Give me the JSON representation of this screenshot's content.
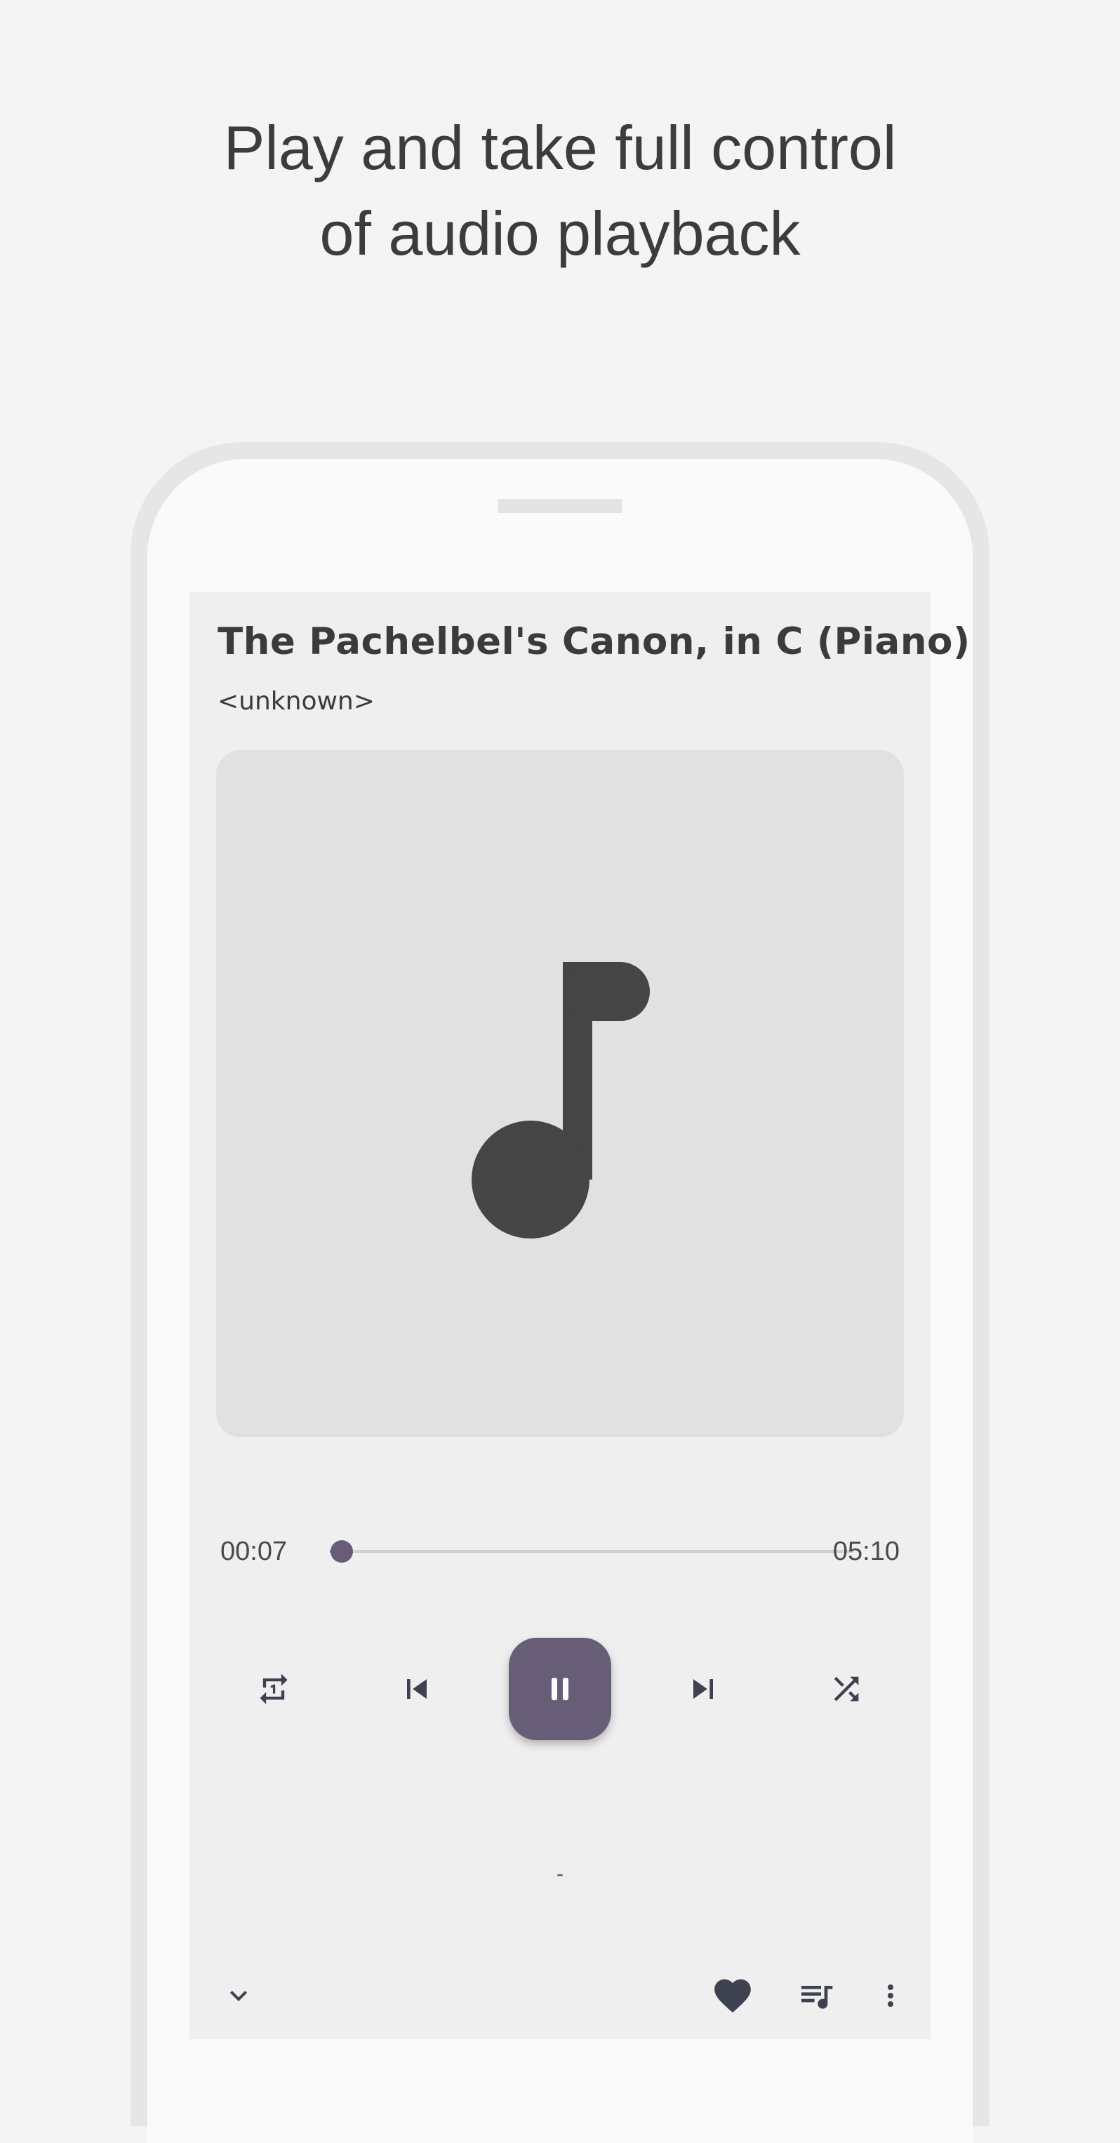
{
  "headline": {
    "line1": "Play and take full control",
    "line2": "of audio playback"
  },
  "player": {
    "title": "The Pachelbel's Canon, in C (Piano)",
    "artist": "<unknown>",
    "artwork_icon": "music-note-icon",
    "elapsed": "00:07",
    "total": "05:10",
    "progress_fraction": 0.023,
    "lyric_placeholder": "-"
  },
  "controls": {
    "repeat_icon": "repeat-one-icon",
    "previous_icon": "skip-previous-icon",
    "play_pause_icon": "pause-icon",
    "next_icon": "skip-next-icon",
    "shuffle_icon": "shuffle-icon"
  },
  "bottom_bar": {
    "collapse_icon": "chevron-down-icon",
    "like_icon": "heart-icon",
    "queue_icon": "queue-music-icon",
    "more_icon": "more-vert-icon"
  },
  "colors": {
    "accent": "#675d76",
    "icon": "#3d4150",
    "background": "#f4f4f4",
    "screen": "#efefef",
    "artwork_bg": "#e1e1e1"
  }
}
